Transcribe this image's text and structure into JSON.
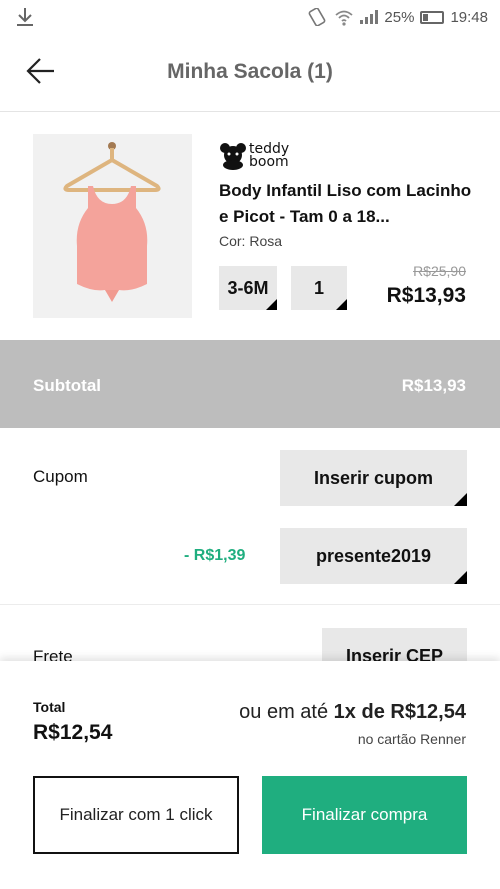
{
  "statusbar": {
    "battery": "25%",
    "time": "19:48",
    "icons": [
      "download-icon",
      "vibrate-icon",
      "wifi-icon",
      "signal-icon",
      "battery-icon"
    ]
  },
  "header": {
    "title": "Minha Sacola (1)",
    "back_icon": "arrow-left-icon"
  },
  "product": {
    "brand_line1": "teddy",
    "brand_line2": "boom",
    "title": "Body Infantil Liso com Lacinho e Picot - Tam 0 a 18...",
    "color": "Cor: Rosa",
    "size": "3-6M",
    "quantity": "1",
    "old_price": "R$25,90",
    "price": "R$13,93",
    "image_colors": {
      "body": "#f4a39b",
      "hanger": "#e0b98a",
      "bg": "#f1f1f1"
    }
  },
  "subtotal": {
    "label": "Subtotal",
    "value": "R$13,93"
  },
  "coupon": {
    "label": "Cupom",
    "insert_button": "Inserir cupom",
    "applied_discount": "- R$1,39",
    "applied_code": "presente2019"
  },
  "shipping": {
    "label": "Frete",
    "insert_button": "Inserir CEP"
  },
  "footer": {
    "total_label": "Total",
    "total_value": "R$12,54",
    "installment_prefix": "ou em até",
    "installment_value": "1x de R$12,54",
    "installment_note": "no cartão Renner",
    "one_click_button": "Finalizar com 1 click",
    "checkout_button": "Finalizar compra"
  },
  "colors": {
    "accent": "#1fae7f",
    "subtotal_bg": "#bdbdbd",
    "button_bg": "#e8e8e8"
  }
}
